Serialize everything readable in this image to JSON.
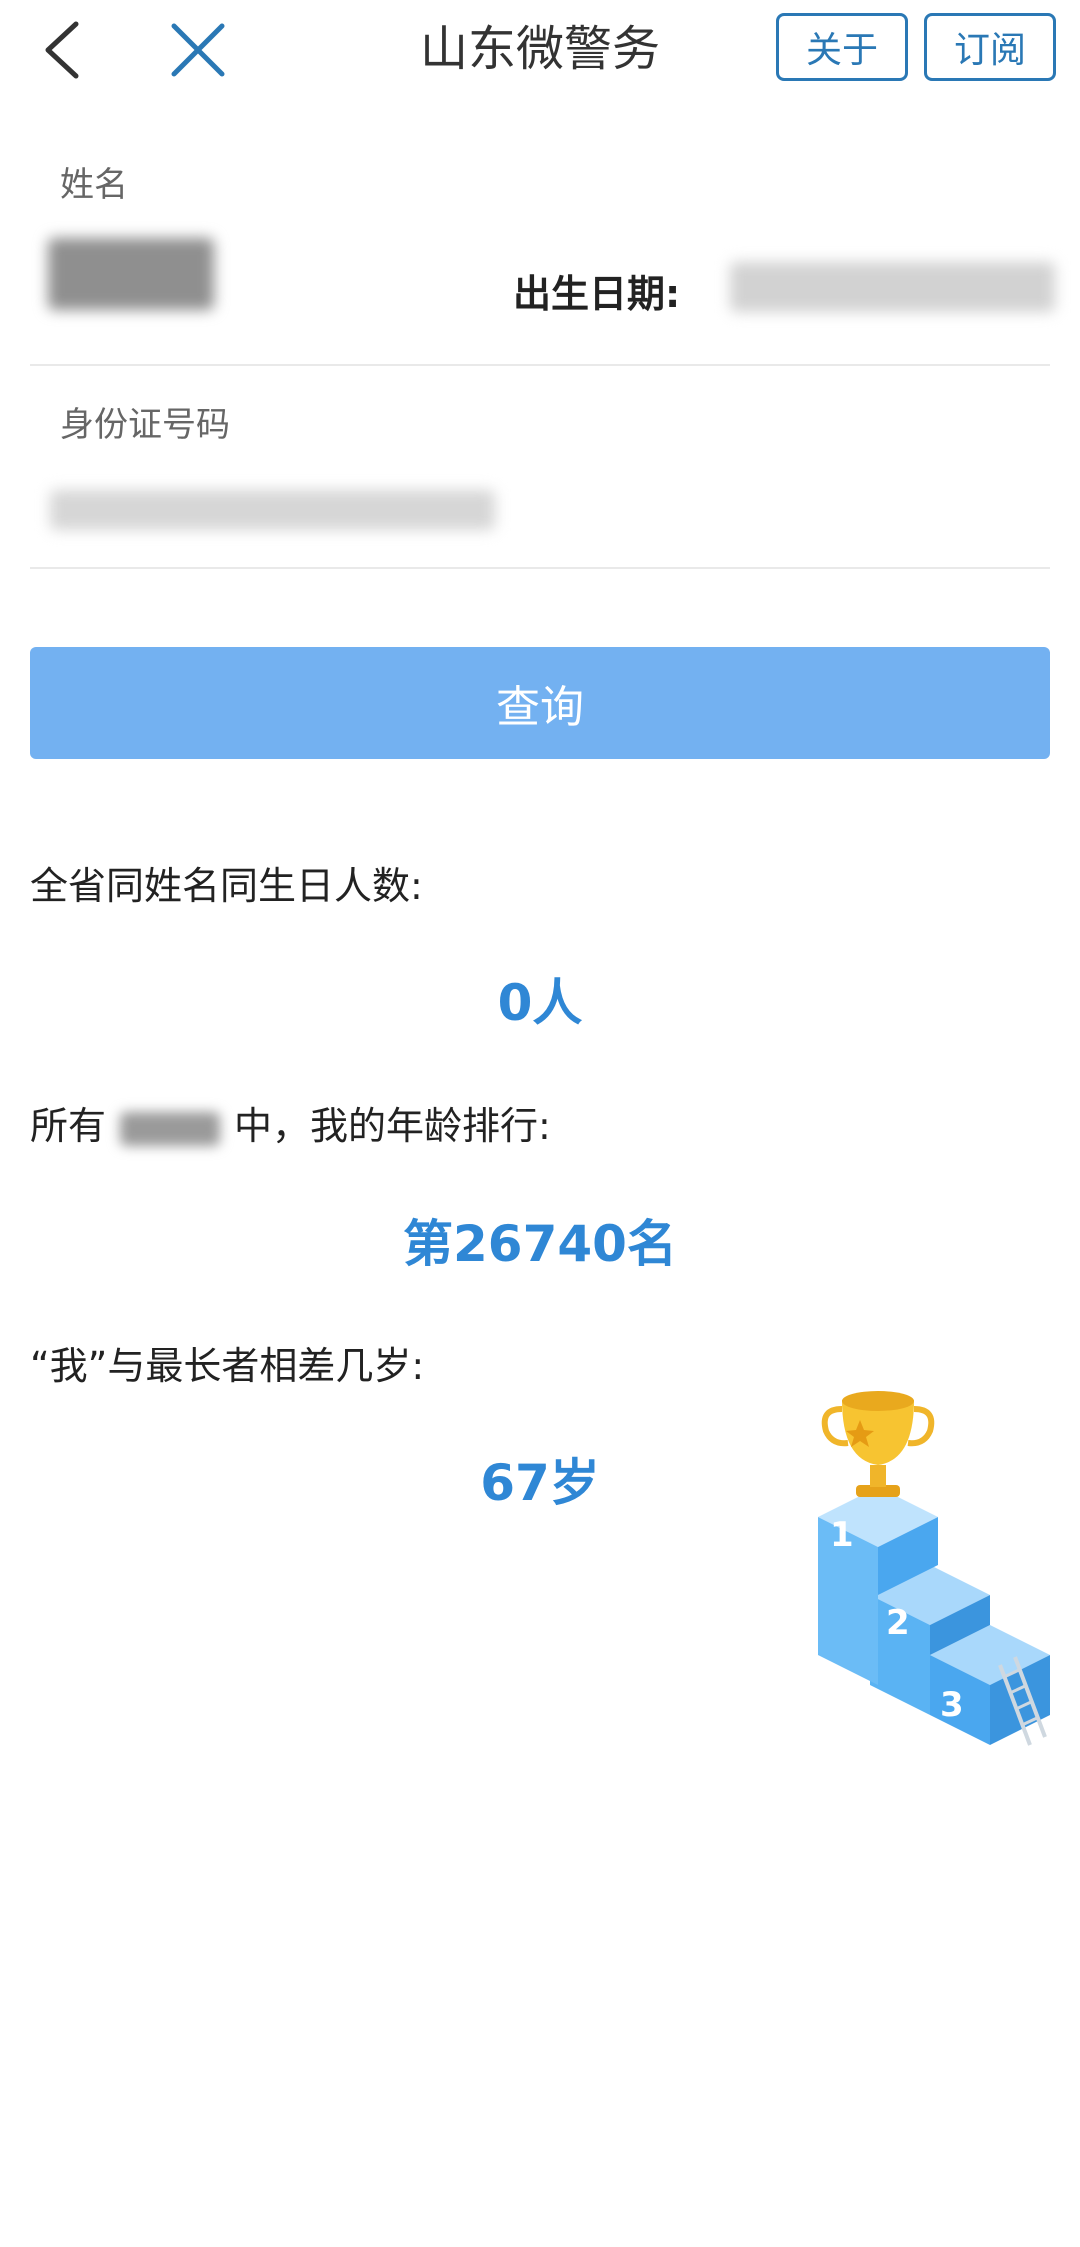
{
  "header": {
    "back_icon": "chevron-left-icon",
    "close_icon": "close-icon",
    "title": "山东微警务",
    "about_label": "关于",
    "subscribe_label": "订阅"
  },
  "form": {
    "name_label": "姓名",
    "birth_label": "出生日期:",
    "id_label": "身份证号码"
  },
  "query_button": "查询",
  "results": {
    "same_count_label": "全省同姓名同生日人数:",
    "same_count_value": "0人",
    "rank_prefix": "所有",
    "rank_suffix": "中，我的年龄排行:",
    "rank_value": "第26740名",
    "diff_label": "“我”与最长者相差几岁:",
    "diff_value": "67岁"
  },
  "podium": {
    "place_1": "1",
    "place_2": "2",
    "place_3": "3"
  },
  "colors": {
    "accent": "#2f87d5",
    "button": "#73b1f1",
    "border": "#2a78b5"
  }
}
